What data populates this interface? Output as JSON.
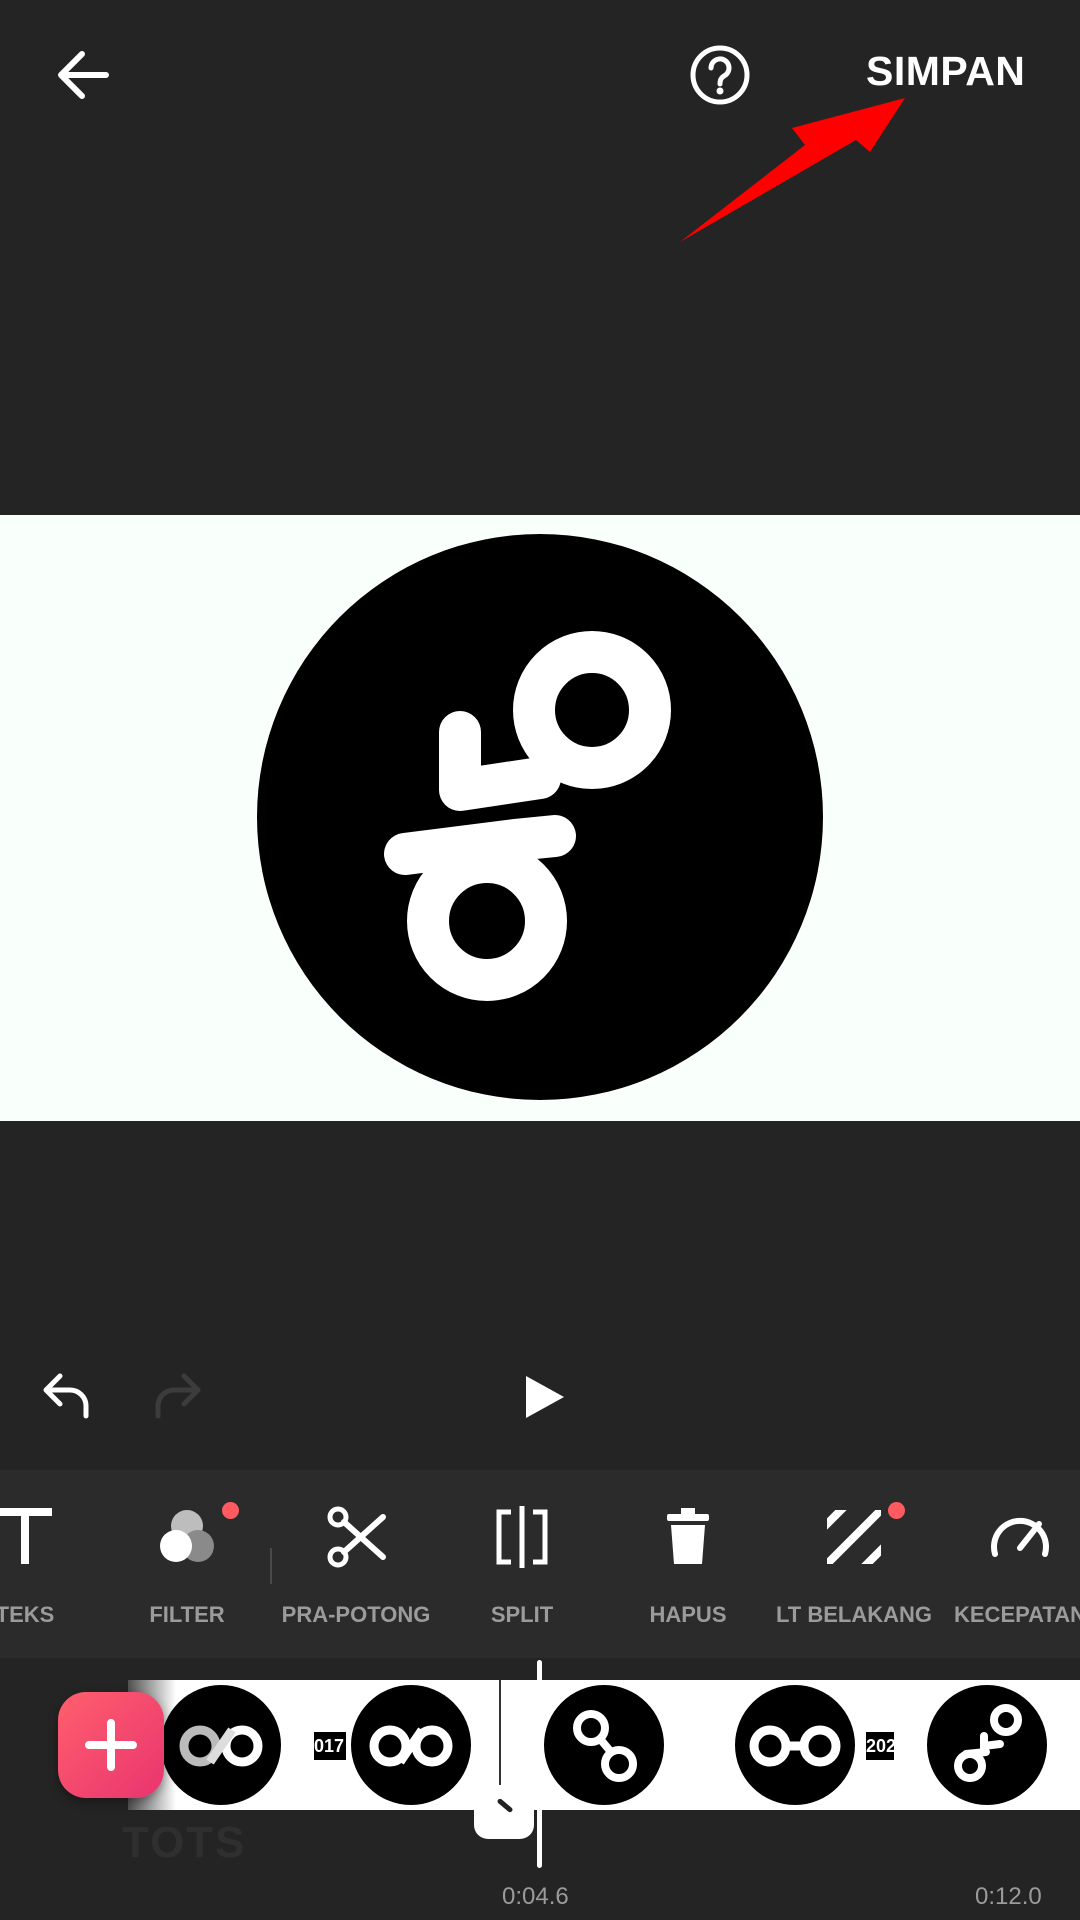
{
  "topbar": {
    "save_label": "SIMPAN"
  },
  "toolbar": {
    "tools": [
      {
        "label": "TEKS",
        "icon": "text-icon"
      },
      {
        "label": "FILTER",
        "icon": "filter-icon"
      },
      {
        "label": "PRA-POTONG",
        "icon": "scissors-icon"
      },
      {
        "label": "SPLIT",
        "icon": "split-icon"
      },
      {
        "label": "HAPUS",
        "icon": "trash-icon"
      },
      {
        "label": "LT BELAKANG",
        "icon": "background-stripes-icon"
      },
      {
        "label": "KECEPATAN",
        "icon": "speedometer-icon"
      }
    ]
  },
  "timeline": {
    "tags": [
      "017",
      "202"
    ],
    "ghost_text": "TOTS",
    "current_time": "0:04.6",
    "total_time": "0:12.0"
  },
  "colors": {
    "background": "#242424",
    "toolbar": "#2b2b2b",
    "accent_dot": "#ff5a5f",
    "add_button": "#f24468",
    "annotation_arrow": "#ff0000"
  }
}
